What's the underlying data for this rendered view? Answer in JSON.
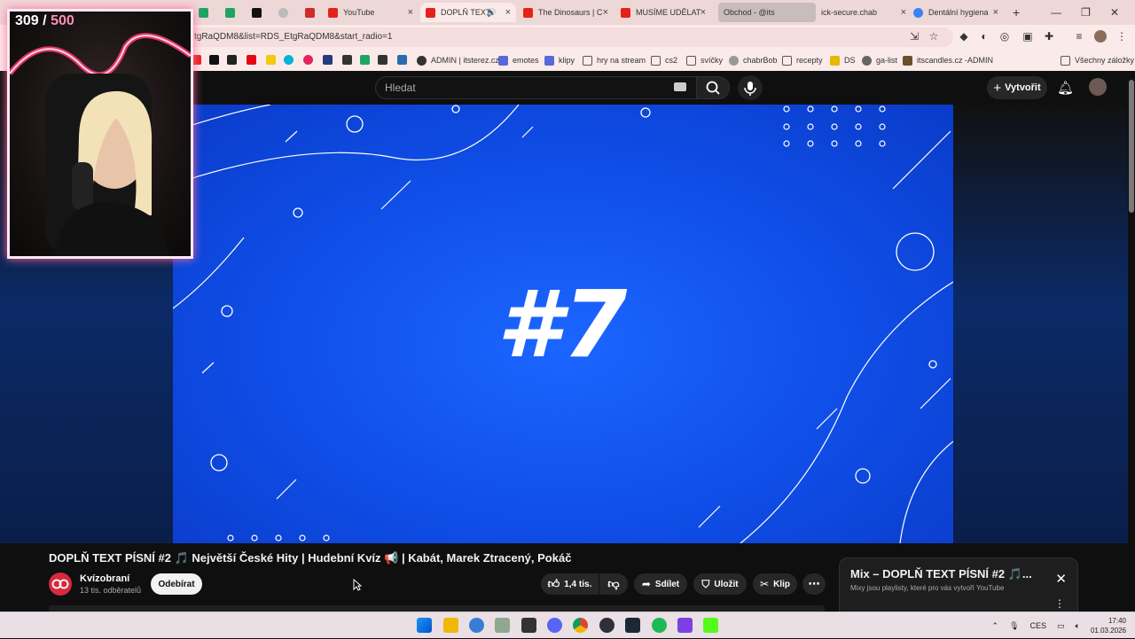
{
  "browser": {
    "tabs": [
      {
        "title": "YouTube",
        "favicon_color": "#e62117"
      },
      {
        "title": "DOPLŇ TEXT",
        "favicon_color": "#e62117",
        "active": true
      },
      {
        "title": "The Dinosaurs | C",
        "favicon_color": "#e62117"
      },
      {
        "title": "MUSÍME UDĚLAT",
        "favicon_color": "#e62117"
      },
      {
        "title": "Obchod - @its",
        "favicon_color": "#888888"
      },
      {
        "title": "ick-secure.chab",
        "favicon_color": "#888888"
      },
      {
        "title": "Dentální hygiena",
        "favicon_color": "#3b82f6"
      }
    ],
    "url": "tgRaQDM8&list=RDS_EtgRaQDM8&start_radio=1",
    "bookmarks": [
      {
        "label": "ADMIN | itsterez.cz"
      },
      {
        "label": "emotes"
      },
      {
        "label": "klipy"
      },
      {
        "label": "hry na stream"
      },
      {
        "label": "cs2"
      },
      {
        "label": "svíčky"
      },
      {
        "label": "chabrBob"
      },
      {
        "label": "recepty"
      },
      {
        "label": "DS"
      },
      {
        "label": "ga-list"
      },
      {
        "label": "itscandles.cz -ADMIN"
      },
      {
        "label": "Všechny záložky"
      }
    ]
  },
  "youtube": {
    "search_placeholder": "Hledat",
    "create_label": "Vytvořit",
    "video_overlay_text": "#7",
    "video_title": "DOPLŇ TEXT PÍSNÍ #2 🎵 Největší České Hity | Hudební Kvíz 📢 | Kabát, Marek Ztracený, Pokáč",
    "channel_name": "Kvízobraní",
    "channel_subs": "13 tis. odběratelů",
    "subscribe_label": "Odebírat",
    "like_count": "1,4 tis.",
    "share_label": "Sdílet",
    "save_label": "Uložit",
    "clip_label": "Klip",
    "mix_title": "Mix – DOPLŇ TEXT PÍSNÍ #2 🎵...",
    "mix_subtitle": "Mixy jsou playlisty, které pro vás vytvoří YouTube"
  },
  "webcam": {
    "count_current": "309",
    "count_separator": "/",
    "count_total": "500"
  },
  "taskbar": {
    "language": "CES",
    "time": "17:40",
    "date": "01.03.2026"
  }
}
